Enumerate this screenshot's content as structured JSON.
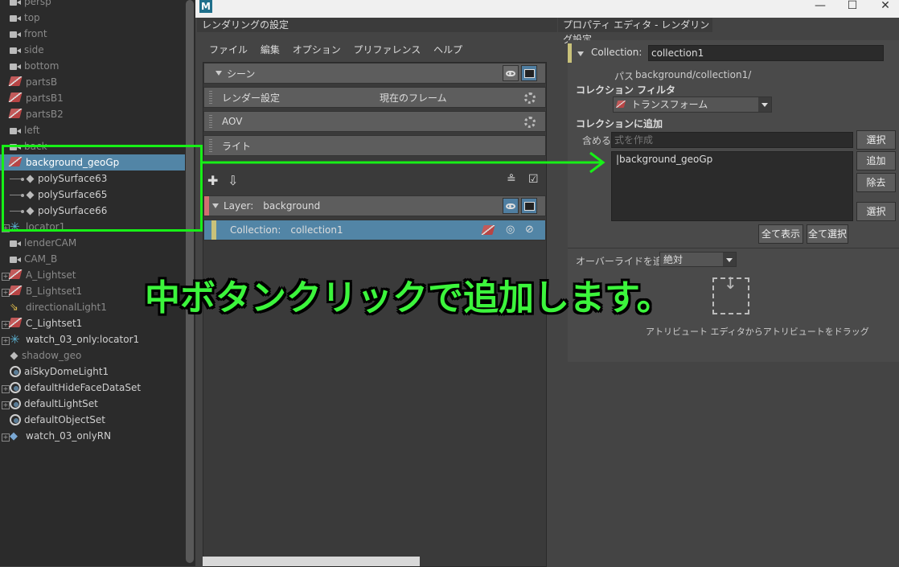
{
  "outliner": {
    "items": [
      {
        "label": "persp",
        "type": "camera",
        "dim": true
      },
      {
        "label": "top",
        "type": "camera",
        "dim": true
      },
      {
        "label": "front",
        "type": "camera",
        "dim": true
      },
      {
        "label": "side",
        "type": "camera",
        "dim": true
      },
      {
        "label": "bottom",
        "type": "camera",
        "dim": true
      },
      {
        "label": "partsB",
        "type": "set",
        "dim": true
      },
      {
        "label": "partsB1",
        "type": "set",
        "dim": true
      },
      {
        "label": "partsB2",
        "type": "set",
        "dim": true
      },
      {
        "label": "left",
        "type": "camera",
        "dim": true
      },
      {
        "label": "back",
        "type": "camera",
        "dim": true
      },
      {
        "label": "background_geoGp",
        "type": "set",
        "selected": true
      },
      {
        "label": "polySurface63",
        "type": "mesh"
      },
      {
        "label": "polySurface65",
        "type": "mesh"
      },
      {
        "label": "polySurface66",
        "type": "mesh"
      },
      {
        "label": "locator1",
        "type": "locator",
        "dim": true
      },
      {
        "label": "lenderCAM",
        "type": "camera",
        "dim": true
      },
      {
        "label": "CAM_B",
        "type": "camera",
        "dim": true
      },
      {
        "label": "A_Lightset",
        "type": "set",
        "dim": true
      },
      {
        "label": "B_Lightset1",
        "type": "set",
        "dim": true
      },
      {
        "label": "directionalLight1",
        "type": "light",
        "dim": true
      },
      {
        "label": "C_Lightset1",
        "type": "set"
      },
      {
        "label": "watch_03_only:locator1",
        "type": "locator"
      },
      {
        "label": "shadow_geo",
        "type": "mesh",
        "dim": true
      },
      {
        "label": "aiSkyDomeLight1",
        "type": "globe"
      },
      {
        "label": "defaultHideFaceDataSet",
        "type": "objset"
      },
      {
        "label": "defaultLightSet",
        "type": "objset"
      },
      {
        "label": "defaultObjectSet",
        "type": "objset"
      },
      {
        "label": "watch_03_onlyRN",
        "type": "ref"
      }
    ]
  },
  "render_setup": {
    "title": "レンダリングの設定",
    "menu": [
      "ファイル",
      "編集",
      "オプション",
      "プリファレンス",
      "ヘルプ"
    ],
    "scene_label": "シーン",
    "render_settings": "レンダー設定",
    "current_frame": "現在のフレーム",
    "aov": "AOV",
    "light": "ライト",
    "layer_prefix": "Layer:",
    "layer_name": "background",
    "collection_prefix": "Collection:",
    "collection_name": "collection1"
  },
  "property_editor": {
    "title": "プロパティ エディタ - レンダリング設定",
    "collection_label": "Collection:",
    "collection_value": "collection1",
    "path_label": "パス",
    "path_value": "background/collection1/",
    "filter_label": "コレクション フィルタ",
    "filter_value": "トランスフォーム",
    "add_label": "コレクションに追加",
    "include_label": "含める",
    "expression_placeholder": "式を作成",
    "select_button": "選択",
    "list_item": "|background_geoGp",
    "add_button": "追加",
    "remove_button": "除去",
    "select_button2": "選択",
    "show_all_button": "全て表示",
    "select_all_button": "全て選択",
    "override_label": "オーバーライドを追加",
    "override_value": "絶対",
    "drag_hint": "アトリビュート エディタからアトリビュートをドラッグ"
  },
  "annotation": {
    "text": "中ボタンクリックで追加します。"
  },
  "colors": {
    "selection_blue": "#5285a6",
    "annotation_green": "#3cf53c",
    "layer_marker": "#d07070",
    "collection_marker": "#c9c27a"
  }
}
